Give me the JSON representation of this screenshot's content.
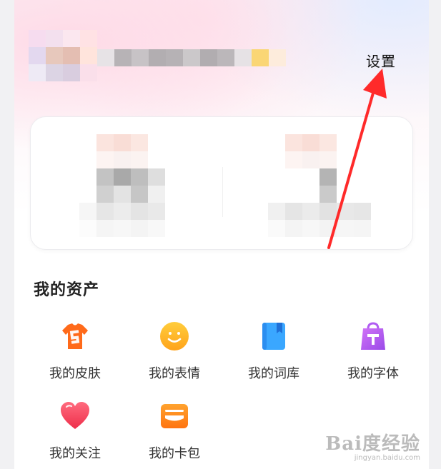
{
  "header": {
    "settings_label": "设置"
  },
  "assets": {
    "title": "我的资产",
    "items": [
      {
        "label": "我的皮肤",
        "icon": "shirt-icon",
        "color": "#ff6a1a"
      },
      {
        "label": "我的表情",
        "icon": "smiley-icon",
        "color": "#ffb42a"
      },
      {
        "label": "我的词库",
        "icon": "book-icon",
        "color": "#3aa7ff"
      },
      {
        "label": "我的字体",
        "icon": "font-bag-icon",
        "color": "#b05cf2"
      },
      {
        "label": "我的关注",
        "icon": "heart-icon",
        "color": "#f5475f"
      },
      {
        "label": "我的卡包",
        "icon": "card-wallet-icon",
        "color": "#ff8a1e"
      }
    ]
  },
  "watermark": {
    "main": "Bai度经验",
    "sub": "jingyan.baidu.com"
  },
  "colors": {
    "arrow": "#ff2a2a",
    "background": "#f1f1f3"
  }
}
